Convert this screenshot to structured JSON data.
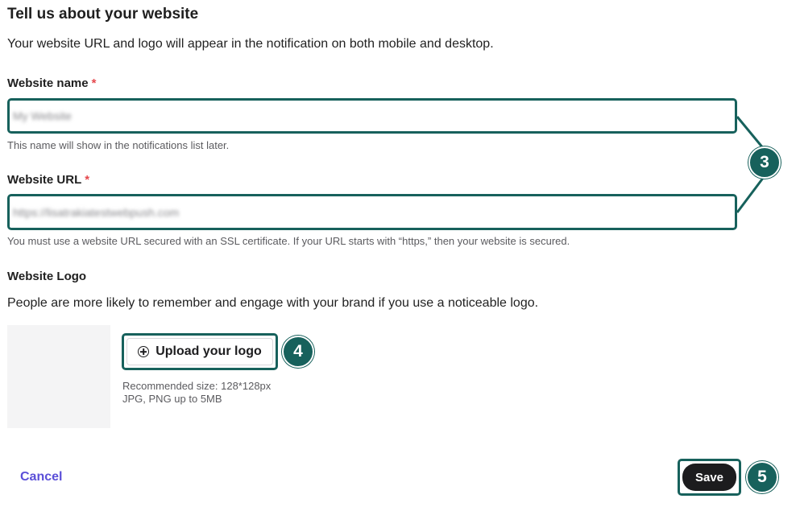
{
  "header": {
    "title": "Tell us about your website",
    "subtitle": "Your website URL and logo will appear in the notification on both mobile and desktop."
  },
  "website_name": {
    "label": "Website name",
    "required_mark": "*",
    "value": "My Website",
    "hint": "This name will show in the notifications list later."
  },
  "website_url": {
    "label": "Website URL",
    "required_mark": "*",
    "value": "https://lisatrakiatestwebpush.com",
    "hint": "You must use a website URL secured with an SSL certificate. If your URL starts with “https,” then your website is secured."
  },
  "logo": {
    "label": "Website Logo",
    "description": "People are more likely to remember and engage with your brand if you use a noticeable logo.",
    "upload_label": "Upload your logo",
    "recommended": "Recommended size: 128*128px JPG, PNG up to 5MB"
  },
  "steps": {
    "three": "3",
    "four": "4",
    "five": "5"
  },
  "footer": {
    "cancel_label": "Cancel",
    "save_label": "Save"
  },
  "colors": {
    "highlight": "#17615c",
    "cancel": "#5b4fd8",
    "required": "#e5484d",
    "save_bg": "#1c1c1e"
  }
}
